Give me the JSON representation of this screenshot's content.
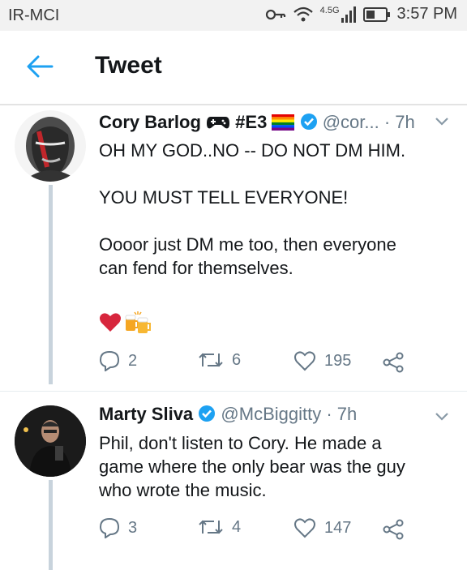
{
  "status_bar": {
    "carrier": "IR-MCI",
    "network": "4.5G",
    "time": "3:57 PM"
  },
  "app_bar": {
    "title": "Tweet"
  },
  "tweets": [
    {
      "name": "Cory Barlog",
      "name_extra": "#E3",
      "handle": "@cor...",
      "time": "· 7h",
      "lines": [
        "OH MY GOD..NO -- DO NOT DM HIM.",
        "YOU MUST TELL EVERYONE!",
        "Oooor just DM me too, then everyone",
        "can fend for themselves."
      ],
      "emoji": [
        "red-heart",
        "beer-mugs"
      ],
      "replies": "2",
      "retweets": "6",
      "likes": "195"
    },
    {
      "name": "Marty Sliva",
      "handle": "@McBiggitty",
      "time": "· 7h",
      "lines": [
        "Phil, don't listen to Cory. He made a",
        "game where the only bear was the guy",
        "who wrote the music."
      ],
      "replies": "3",
      "retweets": "4",
      "likes": "147"
    }
  ],
  "colors": {
    "accent": "#1da1f2",
    "secondary_text": "#657786",
    "thread_line": "#c8d3dc"
  }
}
